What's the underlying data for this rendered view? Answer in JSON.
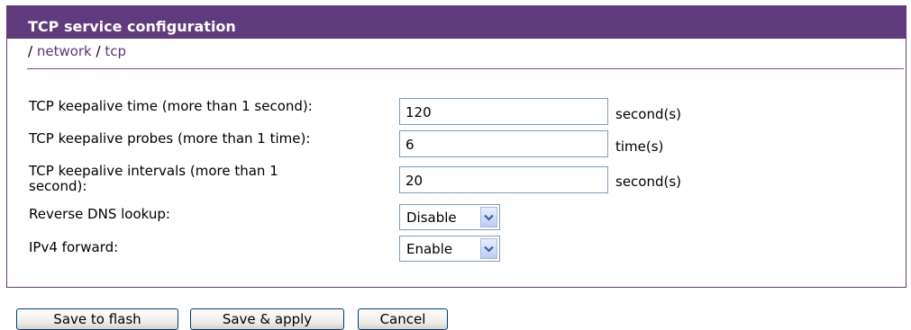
{
  "header": {
    "title": "TCP service configuration"
  },
  "breadcrumb": {
    "sep1": "/ ",
    "network": "network",
    "sep2": " / ",
    "tcp": "tcp"
  },
  "form": {
    "keepalive_time": {
      "label": "TCP keepalive time (more than 1 second):",
      "value": "120",
      "unit": "second(s)"
    },
    "keepalive_probes": {
      "label": "TCP keepalive probes (more than 1 time):",
      "value": "6",
      "unit": "time(s)"
    },
    "keepalive_intervals": {
      "label_line1": "TCP keepalive intervals (more than 1",
      "label_line2": "second):",
      "value": "20",
      "unit": "second(s)"
    },
    "reverse_dns": {
      "label": "Reverse DNS lookup:",
      "value": "Disable"
    },
    "ipv4_forward": {
      "label": "IPv4 forward:",
      "value": "Enable"
    }
  },
  "buttons": {
    "save_flash": "Save to flash",
    "save_apply": "Save & apply",
    "cancel": "Cancel"
  }
}
